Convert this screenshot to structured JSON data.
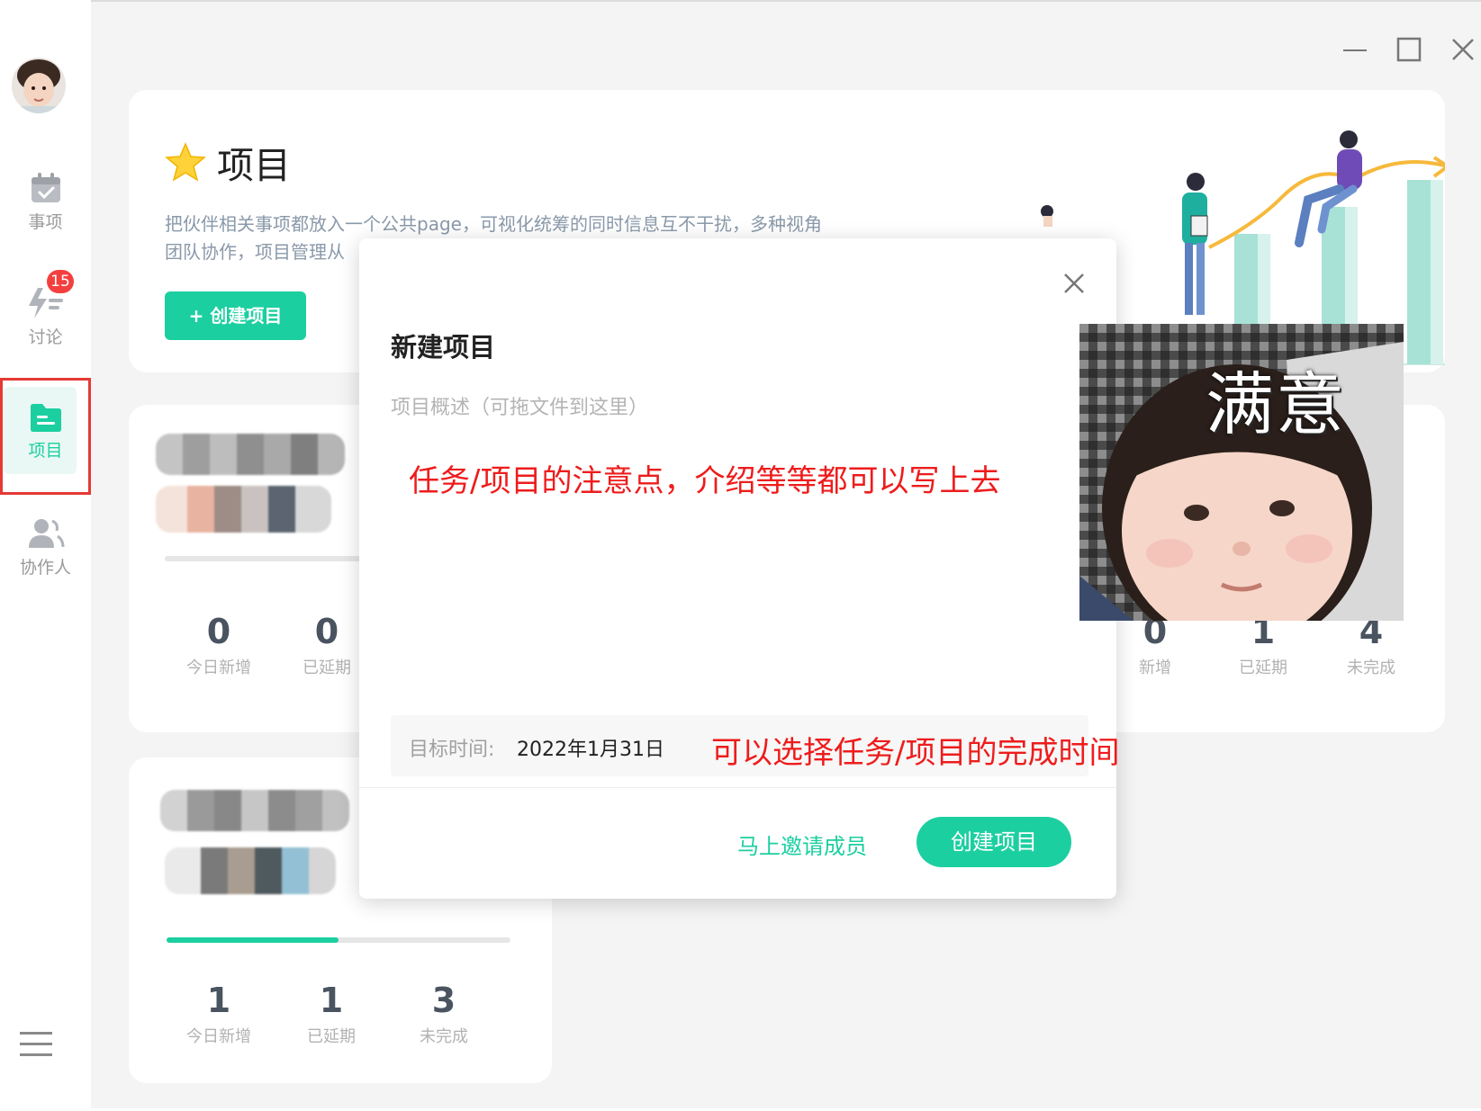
{
  "sidebar": {
    "items": [
      {
        "label": "事项",
        "icon": "calendar-check-icon"
      },
      {
        "label": "讨论",
        "icon": "lightning-list-icon",
        "badge": "15"
      },
      {
        "label": "项目",
        "icon": "folder-icon",
        "active": true
      },
      {
        "label": "协作人",
        "icon": "people-icon"
      }
    ],
    "menu_icon": "hamburger-menu-icon"
  },
  "window_controls": [
    "minimize-icon",
    "maximize-icon",
    "close-icon"
  ],
  "hero": {
    "title": "项目",
    "title_icon": "star-icon",
    "description_line1": "把伙伴相关事项都放入一个公共page，可视化统筹的同时信息互不干扰，多种视角",
    "description_line2": "团队协作，项目管理从",
    "create_button": "+ 创建项目"
  },
  "project_card_a": {
    "stats_left": [
      {
        "value": "0",
        "label": "今日新增"
      },
      {
        "value": "0",
        "label": "已延期"
      }
    ],
    "stats_right": [
      {
        "value": "0",
        "label": "新增"
      },
      {
        "value": "1",
        "label": "已延期"
      },
      {
        "value": "4",
        "label": "未完成"
      }
    ]
  },
  "project_card_b": {
    "progress": 0.5,
    "stats": [
      {
        "value": "1",
        "label": "今日新增"
      },
      {
        "value": "1",
        "label": "已延期"
      },
      {
        "value": "3",
        "label": "未完成"
      }
    ]
  },
  "modal": {
    "title": "新建项目",
    "description_placeholder": "项目概述（可拖文件到这里）",
    "annotation_description": "任务/项目的注意点，介绍等等都可以写上去",
    "date_label": "目标时间:",
    "date_value": "2022年1月31日",
    "annotation_date": "可以选择任务/项目的完成时间",
    "invite_link": "马上邀请成员",
    "create_button": "创建项目"
  },
  "sticker": {
    "text": "满意"
  },
  "colors": {
    "accent": "#1ccfa0",
    "annotation_red": "#ee1c1c",
    "badge_red": "#f43f3f",
    "highlight_frame": "#e53935"
  }
}
